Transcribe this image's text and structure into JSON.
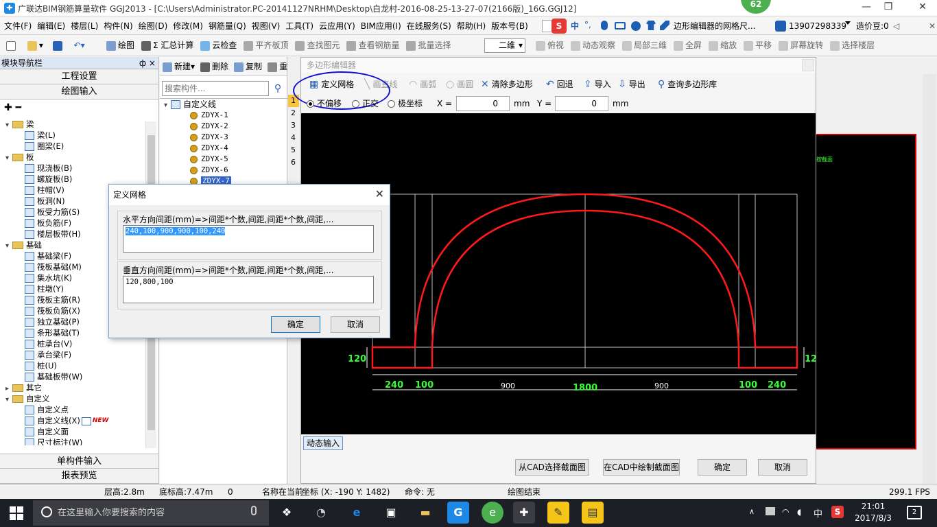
{
  "title_bar": {
    "app_title": "广联达BIM钢筋算量软件 GGJ2013 - [C:\\Users\\Administrator.PC-20141127NRHM\\Desktop\\白龙村-2016-08-25-13-27-07(2166版)_16G.GGJ12]",
    "badge": "62"
  },
  "menu": {
    "items": [
      "文件(F)",
      "编辑(E)",
      "楼层(L)",
      "构件(N)",
      "绘图(D)",
      "修改(M)",
      "钢筋量(Q)",
      "视图(V)",
      "工具(T)",
      "云应用(Y)",
      "BIM应用(I)",
      "在线服务(S)",
      "帮助(H)",
      "版本号(B)"
    ],
    "ime_ch": "中",
    "ime_punct": "°,",
    "ticker": "边形编辑器的网格尺...",
    "phone": "13907298339",
    "price_label": "造价豆:0"
  },
  "toolbar": {
    "items": [
      "绘图",
      "Σ 汇总计算",
      "云检查",
      "平齐板顶",
      "查找图元",
      "查看钢筋量",
      "批量选择"
    ],
    "view_mode": "二维",
    "view_items": [
      "俯视",
      "动态观察",
      "局部三维",
      "全屏",
      "缩放",
      "平移",
      "屏幕旋转",
      "选择楼层"
    ]
  },
  "nav": {
    "header": "模块导航栏",
    "pin": "ф ×",
    "btn_project": "工程设置",
    "btn_draw": "绘图输入",
    "tree": [
      {
        "type": "group",
        "label": "梁",
        "expanded": true
      },
      {
        "type": "leaf",
        "label": "梁(L)"
      },
      {
        "type": "leaf",
        "label": "圈梁(E)"
      },
      {
        "type": "group",
        "label": "板",
        "expanded": true
      },
      {
        "type": "leaf",
        "label": "现浇板(B)"
      },
      {
        "type": "leaf",
        "label": "螺旋板(B)"
      },
      {
        "type": "leaf",
        "label": "柱帽(V)"
      },
      {
        "type": "leaf",
        "label": "板洞(N)"
      },
      {
        "type": "leaf",
        "label": "板受力筋(S)"
      },
      {
        "type": "leaf",
        "label": "板负筋(F)"
      },
      {
        "type": "leaf",
        "label": "楼层板带(H)"
      },
      {
        "type": "group",
        "label": "基础",
        "expanded": true
      },
      {
        "type": "leaf",
        "label": "基础梁(F)"
      },
      {
        "type": "leaf",
        "label": "筏板基础(M)"
      },
      {
        "type": "leaf",
        "label": "集水坑(K)"
      },
      {
        "type": "leaf",
        "label": "柱墩(Y)"
      },
      {
        "type": "leaf",
        "label": "筏板主筋(R)"
      },
      {
        "type": "leaf",
        "label": "筏板负筋(X)"
      },
      {
        "type": "leaf",
        "label": "独立基础(P)"
      },
      {
        "type": "leaf",
        "label": "条形基础(T)"
      },
      {
        "type": "leaf",
        "label": "桩承台(V)"
      },
      {
        "type": "leaf",
        "label": "承台梁(F)"
      },
      {
        "type": "leaf",
        "label": "桩(U)"
      },
      {
        "type": "leaf",
        "label": "基础板带(W)"
      },
      {
        "type": "group",
        "label": "其它",
        "expanded": false
      },
      {
        "type": "group",
        "label": "自定义",
        "expanded": true
      },
      {
        "type": "leaf",
        "label": "自定义点"
      },
      {
        "type": "leaf",
        "label": "自定义线(X)",
        "badge": "NEW",
        "selected": true
      },
      {
        "type": "leaf",
        "label": "自定义面"
      },
      {
        "type": "leaf",
        "label": "尺寸标注(W)"
      }
    ],
    "btn_single": "单构件输入",
    "btn_report": "报表预览"
  },
  "comp": {
    "toolbar": [
      "新建▾",
      "删除",
      "复制",
      "重命"
    ],
    "search_placeholder": "搜索构件...",
    "root": "自定义线",
    "items": [
      "ZDYX-1",
      "ZDYX-2",
      "ZDYX-3",
      "ZDYX-4",
      "ZDYX-5",
      "ZDYX-6",
      "ZDYX-7"
    ],
    "selected_index": 6,
    "side_numbers": [
      "1",
      "2",
      "3",
      "4",
      "5",
      "6"
    ]
  },
  "poly_editor": {
    "title": "多边形编辑器",
    "tools": [
      "定义网格",
      "画直线",
      "画弧",
      "画圆",
      "清除多边形",
      "回退",
      "导入",
      "导出",
      "查询多边形库"
    ],
    "mode_options": [
      "不偏移",
      "正交",
      "极坐标"
    ],
    "mode_selected": 0,
    "x_label": "X =",
    "x_value": "0",
    "y_label": "Y =",
    "y_value": "0",
    "unit": "mm",
    "dynamic_input": "动态输入",
    "btn_from_cad": "从CAD选择截面图",
    "btn_draw_cad": "在CAD中绘制截面图",
    "btn_ok": "确定",
    "btn_cancel": "取消",
    "drawing": {
      "dims_bottom": [
        "240",
        "100",
        "900",
        "1800",
        "900",
        "100",
        "240"
      ],
      "dims_side": [
        "120",
        "12"
      ],
      "arch_color": "#ff1a1a",
      "dim_color": "#33ff33",
      "grid_color": "#bfbfbf"
    }
  },
  "grid_dialog": {
    "title": "定义网格",
    "h_label": "水平方向间距(mm)=>间距*个数,间距,间距*个数,间距,...",
    "h_value": "240,100,900,900,100,240",
    "v_label": "垂直方向间距(mm)=>间距*个数,间距,间距*个数,间距,...",
    "v_value": "120,800,100",
    "ok": "确定",
    "cancel": "取消"
  },
  "status": {
    "floor_height": "层高:2.8m",
    "base_height": "底标高:7.47m",
    "zero": "0",
    "name_hint": "名称在当前",
    "coord": "坐标 (X: -190 Y: 1482)",
    "command": "命令: 无",
    "draw_end": "绘图结束",
    "fps": "299.1 FPS"
  },
  "taskbar": {
    "search_placeholder": "在这里输入你要搜索的内容",
    "ime": "中",
    "time": "21:01",
    "date": "2017/8/3",
    "notify_count": "2"
  }
}
